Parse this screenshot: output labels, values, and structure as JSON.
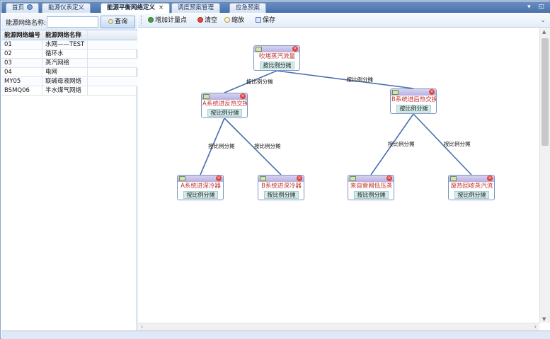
{
  "tabs": [
    {
      "label": "首页",
      "active": false
    },
    {
      "label": "能源仪表定义",
      "active": false
    },
    {
      "label": "能源平衡网络定义",
      "active": true
    },
    {
      "label": "调度预案管理",
      "active": false
    },
    {
      "label": "应急预案",
      "active": false
    }
  ],
  "strip_icons": "▾ ◱",
  "close_glyph": "×",
  "search": {
    "label": "能源网络名称:",
    "value": "",
    "button_label": "查询"
  },
  "table": {
    "headers": [
      "能源网络编号",
      "能源网络名称"
    ],
    "rows": [
      {
        "code": "01",
        "name": "水网——TEST"
      },
      {
        "code": "02",
        "name": "循环水"
      },
      {
        "code": "03",
        "name": "蒸汽网络"
      },
      {
        "code": "04",
        "name": "电网"
      },
      {
        "code": "MY05",
        "name": "联碱母液网络"
      },
      {
        "code": "BSMQ06",
        "name": "半水煤气网络"
      }
    ]
  },
  "toolbar": {
    "add_label": "增加计量点",
    "clear_label": "清空",
    "zoom_label": "缩放",
    "save_label": "保存",
    "right_glyph": "⌄"
  },
  "diagram": {
    "nodes": [
      {
        "id": "n0",
        "name": "吹堵蒸汽流量",
        "mode": "按比例分摊"
      },
      {
        "id": "n1",
        "name": "A系统进反热交换",
        "mode": "按比例分摊"
      },
      {
        "id": "n2",
        "name": "B系统进后热交换",
        "mode": "按比例分摊"
      },
      {
        "id": "n3",
        "name": "A系统进深冷器",
        "mode": "按比例分摊"
      },
      {
        "id": "n4",
        "name": "B系统进深冷器",
        "mode": "按比例分摊"
      },
      {
        "id": "n5",
        "name": "来自管网低压蒸",
        "mode": "按比例分摊"
      },
      {
        "id": "n6",
        "name": "废热回收蒸汽流",
        "mode": "按比例分摊"
      }
    ],
    "edges": [
      {
        "from": "n0",
        "to": "n1",
        "label": "按比例分摊"
      },
      {
        "from": "n0",
        "to": "n2",
        "label": "按比例分摊"
      },
      {
        "from": "n1",
        "to": "n3",
        "label": "按比例分摊"
      },
      {
        "from": "n1",
        "to": "n4",
        "label": "按比例分摊"
      },
      {
        "from": "n2",
        "to": "n5",
        "label": "按比例分摊"
      },
      {
        "from": "n2",
        "to": "n6",
        "label": "按比例分摊"
      }
    ],
    "edge_color": "#4a6fb0"
  },
  "scroll": {
    "up": "▲",
    "down": "▼",
    "left": "‹",
    "right": "›"
  }
}
